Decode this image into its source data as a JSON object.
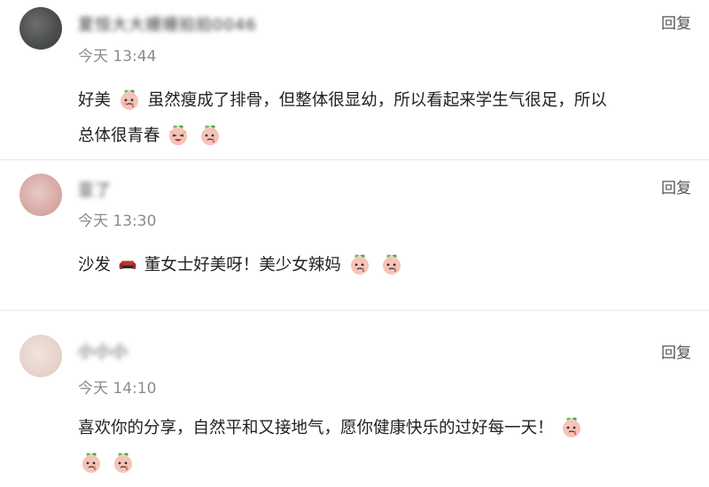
{
  "comments": [
    {
      "user": "夏恒大大姗姗拍拍0046",
      "time": "今天 13:44",
      "reply": "回复",
      "line1_a": "好美",
      "line1_b": "虽然瘦成了排骨，但整体很显幼，所以看起来学生气很足，所以",
      "line2": "总体很青春"
    },
    {
      "user": "亚了",
      "time": "今天 13:30",
      "reply": "回复",
      "line1_a": "沙发",
      "line1_b": "董女士好美呀！美少女辣妈"
    },
    {
      "user": "小小小",
      "time": "今天 14:10",
      "reply": "回复",
      "line1": "喜欢你的分享，自然平和又接地气，愿你健康快乐的过好每一天！"
    }
  ],
  "icons": {
    "emoji": "peach-cry-emoji",
    "sofa": "sofa-icon"
  }
}
